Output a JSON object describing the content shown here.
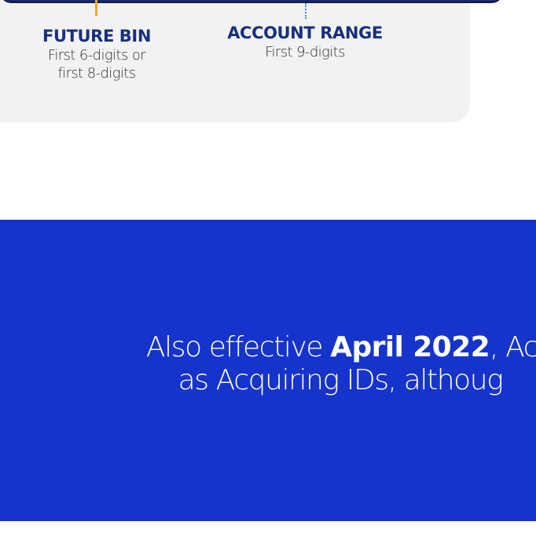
{
  "future_bin": {
    "title": "FUTURE BIN",
    "desc_line1": "First 6-digits or",
    "desc_line2": "first 8-digits"
  },
  "account_range": {
    "title": "ACCOUNT RANGE",
    "desc": "First 9-digits"
  },
  "banner": {
    "line1_prefix": "Also effective ",
    "line1_bold": "April 2022",
    "line1_suffix": ", Ac",
    "line2": "as Acquiring IDs, althoug"
  },
  "colors": {
    "navy_title": "#17307e",
    "banner_blue": "#1634cb",
    "card_gray": "#f2f2f2",
    "connector_orange": "#f0a820",
    "connector_blue": "#3a8ad8"
  }
}
